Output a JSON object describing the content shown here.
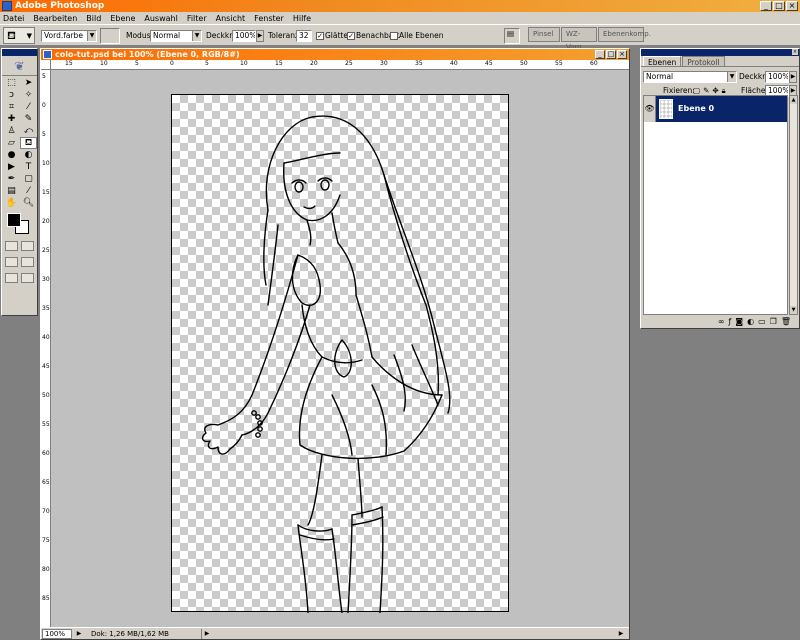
{
  "app": {
    "title": "Adobe Photoshop"
  },
  "menu": [
    "Datei",
    "Bearbeiten",
    "Bild",
    "Ebene",
    "Auswahl",
    "Filter",
    "Ansicht",
    "Fenster",
    "Hilfe"
  ],
  "options": {
    "fill_source": "Vord.farbe",
    "mode_label": "Modus:",
    "mode_value": "Normal",
    "opacity_label": "Deckkr.:",
    "opacity_value": "100%",
    "tolerance_label": "Toleranz:",
    "tolerance_value": "32",
    "antialias_label": "Glätten",
    "contiguous_label": "Benachbart",
    "all_layers_label": "Alle Ebenen",
    "palette_well": [
      "Pinsel",
      "WZ-Vorg.",
      "Ebenenkomp."
    ]
  },
  "document": {
    "title": "colo-tut.psd bei 100% (Ebene 0, RGB/8#)",
    "zoom": "100%",
    "doc_size": "Dok: 1,26 MB/1,62 MB",
    "ruler_top": [
      "15",
      "10",
      "5",
      "0",
      "5",
      "10",
      "15",
      "20",
      "25",
      "30",
      "35",
      "40",
      "45",
      "50",
      "55",
      "60"
    ],
    "ruler_left": [
      "5",
      "0",
      "5",
      "10",
      "15",
      "20",
      "25",
      "30",
      "35",
      "40",
      "45",
      "50",
      "55",
      "60",
      "65",
      "70",
      "75",
      "80",
      "85"
    ]
  },
  "layers_panel": {
    "tabs": [
      "Ebenen",
      "Protokoll"
    ],
    "blend_mode": "Normal",
    "opacity_label": "Deckkr.:",
    "opacity_value": "100%",
    "lock_label": "Fixieren:",
    "fill_label": "Fläche:",
    "fill_value": "100%",
    "layers": [
      {
        "name": "Ebene 0"
      }
    ]
  },
  "icons": {
    "tools": [
      "marquee-icon",
      "move-icon",
      "lasso-icon",
      "magic-wand-icon",
      "crop-icon",
      "slice-icon",
      "healing-icon",
      "brush-icon",
      "stamp-icon",
      "history-brush-icon",
      "eraser-icon",
      "paint-bucket-icon",
      "blur-icon",
      "dodge-icon",
      "path-select-icon",
      "type-icon",
      "pen-icon",
      "shape-icon",
      "notes-icon",
      "eyedropper-icon",
      "hand-icon",
      "zoom-icon"
    ]
  },
  "colors": {
    "title_bar": "#ff6a00",
    "selection": "#0a246a",
    "foreground": "#000000",
    "background": "#ffffff"
  }
}
